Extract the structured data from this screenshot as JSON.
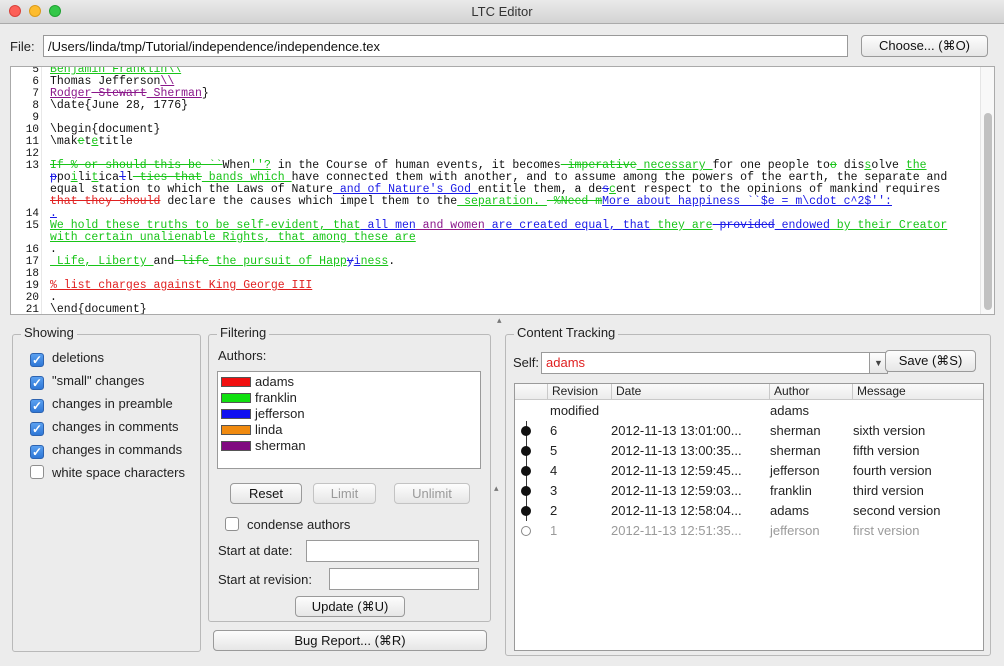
{
  "window": {
    "title": "LTC Editor"
  },
  "file": {
    "label": "File:",
    "path": "/Users/linda/tmp/Tutorial/independence/independence.tex",
    "choose_label": "Choose... (⌘O)"
  },
  "editor": {
    "line_numbers": [
      "5",
      "6",
      "7",
      "8",
      "9",
      "10",
      "11",
      "12",
      "13",
      "",
      "",
      "",
      "14",
      "15",
      "",
      "16",
      "17",
      "18",
      "19",
      "20",
      "21"
    ]
  },
  "showing": {
    "legend": "Showing",
    "options": [
      {
        "label": "deletions",
        "checked": true
      },
      {
        "label": "\"small\" changes",
        "checked": true
      },
      {
        "label": "changes in preamble",
        "checked": true
      },
      {
        "label": "changes in comments",
        "checked": true
      },
      {
        "label": "changes in commands",
        "checked": true
      },
      {
        "label": "white space characters",
        "checked": false
      }
    ]
  },
  "filtering": {
    "legend": "Filtering",
    "authors_label": "Authors:",
    "authors": [
      {
        "name": "adams",
        "color": "#f01010"
      },
      {
        "name": "franklin",
        "color": "#10e010"
      },
      {
        "name": "jefferson",
        "color": "#1010f0"
      },
      {
        "name": "linda",
        "color": "#f08a10"
      },
      {
        "name": "sherman",
        "color": "#800a80"
      }
    ],
    "reset_label": "Reset",
    "limit_label": "Limit",
    "unlimit_label": "Unlimit",
    "condense_label": "condense authors",
    "condense_checked": false,
    "start_date_label": "Start at date:",
    "start_date_value": "",
    "start_rev_label": "Start at revision:",
    "start_rev_value": "",
    "update_label": "Update (⌘U)"
  },
  "bug_report_label": "Bug Report... (⌘R)",
  "tracking": {
    "legend": "Content Tracking",
    "self_label": "Self:",
    "self_value": "adams",
    "save_label": "Save (⌘S)",
    "columns": [
      "Revision",
      "Date",
      "Author",
      "Message"
    ],
    "rows": [
      {
        "rev": "modified",
        "date": "",
        "author": "adams",
        "message": "",
        "dot": "none"
      },
      {
        "rev": "6",
        "date": "2012-11-13 13:01:00...",
        "author": "sherman",
        "message": "sixth version",
        "dot": "filled"
      },
      {
        "rev": "5",
        "date": "2012-11-13 13:00:35...",
        "author": "sherman",
        "message": "fifth version",
        "dot": "filled"
      },
      {
        "rev": "4",
        "date": "2012-11-13 12:59:45...",
        "author": "jefferson",
        "message": "fourth version",
        "dot": "filled"
      },
      {
        "rev": "3",
        "date": "2012-11-13 12:59:03...",
        "author": "franklin",
        "message": "third version",
        "dot": "filled"
      },
      {
        "rev": "2",
        "date": "2012-11-13 12:58:04...",
        "author": "adams",
        "message": "second version",
        "dot": "filled"
      },
      {
        "rev": "1",
        "date": "2012-11-13 12:51:35...",
        "author": "jefferson",
        "message": "first version",
        "dot": "hollow"
      }
    ]
  },
  "code_lines": [
    {
      "segs": [
        [
          "gu",
          "Benjamin Franklin\\\\"
        ]
      ]
    },
    {
      "segs": [
        [
          "",
          "Thomas Jefferson"
        ],
        [
          "pu",
          "\\\\"
        ]
      ]
    },
    {
      "segs": [
        [
          "pu",
          "Rodger"
        ],
        [
          "ps",
          " Stewart"
        ],
        [
          "pu",
          " Sherman"
        ],
        [
          "",
          "}"
        ]
      ]
    },
    {
      "segs": [
        [
          "",
          "\\date{June 28, 1776}"
        ]
      ]
    },
    {
      "segs": [
        [
          "",
          ""
        ]
      ]
    },
    {
      "segs": [
        [
          "",
          "\\begin{document}"
        ]
      ]
    },
    {
      "segs": [
        [
          "",
          "\\mak"
        ],
        [
          "gs",
          "e"
        ],
        [
          "",
          "t"
        ],
        [
          "gu",
          "e"
        ],
        [
          "",
          "title"
        ]
      ]
    },
    {
      "segs": [
        [
          "",
          ""
        ]
      ]
    },
    {
      "segs": [
        [
          "gs",
          "If % or should this be ``"
        ],
        [
          "",
          "When"
        ],
        [
          "gu",
          "''?"
        ],
        [
          "",
          " in the Course of human events, it becomes"
        ],
        [
          "gs",
          " imperative"
        ],
        [
          "gu",
          " necessary "
        ],
        [
          "",
          "for one people to"
        ],
        [
          "gs",
          "o"
        ],
        [
          "",
          " dis"
        ],
        [
          "gu",
          "s"
        ],
        [
          "",
          "olve "
        ],
        [
          "gu",
          "the"
        ]
      ]
    },
    {
      "segs": [
        [
          "bs",
          "p"
        ],
        [
          "",
          "po"
        ],
        [
          "gu",
          "i"
        ],
        [
          "",
          "li"
        ],
        [
          "gu",
          "t"
        ],
        [
          "",
          "ica"
        ],
        [
          "bs",
          "l"
        ],
        [
          "",
          "l"
        ],
        [
          "gs",
          " ties that"
        ],
        [
          "gu",
          " bands which "
        ],
        [
          "",
          "have connected them with another, and to assume among the powers of the earth, the separate and"
        ]
      ]
    },
    {
      "segs": [
        [
          "",
          "equal station to which the Laws of Nature"
        ],
        [
          "bu",
          " and of Nature's God "
        ],
        [
          "",
          "entitle them, a de"
        ],
        [
          "bs",
          "s"
        ],
        [
          "gu",
          "c"
        ],
        [
          "",
          "ent respect to the opinions of mankind requires"
        ]
      ]
    },
    {
      "segs": [
        [
          "rs",
          "that they should"
        ],
        [
          "",
          " declare the causes which impel them to the"
        ],
        [
          "gu",
          " separation. "
        ],
        [
          "gs",
          " %Need m"
        ],
        [
          "bu",
          "More about happiness ``$e = m\\cdot c^2$'':"
        ]
      ]
    },
    {
      "segs": [
        [
          "bu",
          "."
        ]
      ]
    },
    {
      "segs": [
        [
          "gu",
          "We hold these truths to be self-evident, that"
        ],
        [
          "bu",
          " all men"
        ],
        [
          "pu",
          " and women"
        ],
        [
          "bu",
          " are created equal, that"
        ],
        [
          "gu",
          " they are"
        ],
        [
          "bs",
          " provided"
        ],
        [
          "bu",
          " endowed"
        ],
        [
          "gu",
          " by their Creator"
        ]
      ]
    },
    {
      "segs": [
        [
          "gu",
          "with certain unalienable Rights, that among these are"
        ]
      ]
    },
    {
      "segs": [
        [
          "",
          "."
        ]
      ]
    },
    {
      "segs": [
        [
          "gu",
          " Life, Liberty "
        ],
        [
          "",
          "and"
        ],
        [
          "gs",
          " life"
        ],
        [
          "gu",
          " the pursuit of Happ"
        ],
        [
          "bs",
          "y"
        ],
        [
          "bu",
          "i"
        ],
        [
          "gu",
          "ness"
        ],
        [
          "",
          "."
        ]
      ]
    },
    {
      "segs": [
        [
          "",
          ""
        ]
      ]
    },
    {
      "segs": [
        [
          "ru",
          "% list charges against King George III"
        ]
      ]
    },
    {
      "segs": [
        [
          "",
          "."
        ]
      ]
    },
    {
      "segs": [
        [
          "",
          "\\end{document}"
        ]
      ]
    }
  ]
}
